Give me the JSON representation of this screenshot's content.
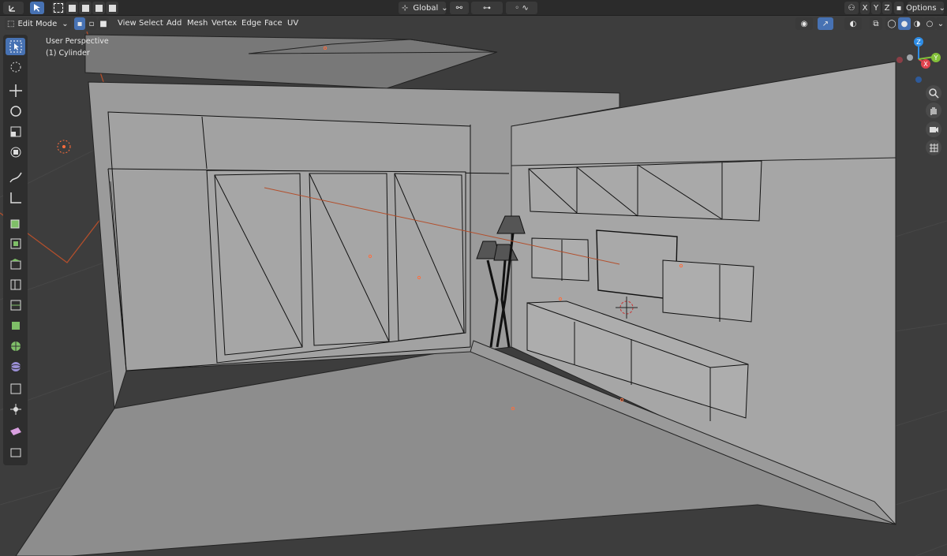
{
  "header": {
    "mode": "Edit Mode",
    "menus": [
      "View",
      "Select",
      "Add",
      "Mesh",
      "Vertex",
      "Edge",
      "Face",
      "UV"
    ],
    "orientation": "Global",
    "options": "Options"
  },
  "viewport": {
    "perspective": "User Perspective",
    "object": "(1) Cylinder"
  },
  "gizmo": {
    "x": "X",
    "y": "Y",
    "z": "Z"
  },
  "axis_buttons": [
    "X",
    "Y",
    "Z"
  ],
  "colors": {
    "accent": "#4772b3",
    "x_axis": "#e0434d",
    "y_axis": "#84c13a",
    "z_axis": "#2e8de6",
    "mesh": "#b9b9b9",
    "origin": "#ff6d3c"
  }
}
